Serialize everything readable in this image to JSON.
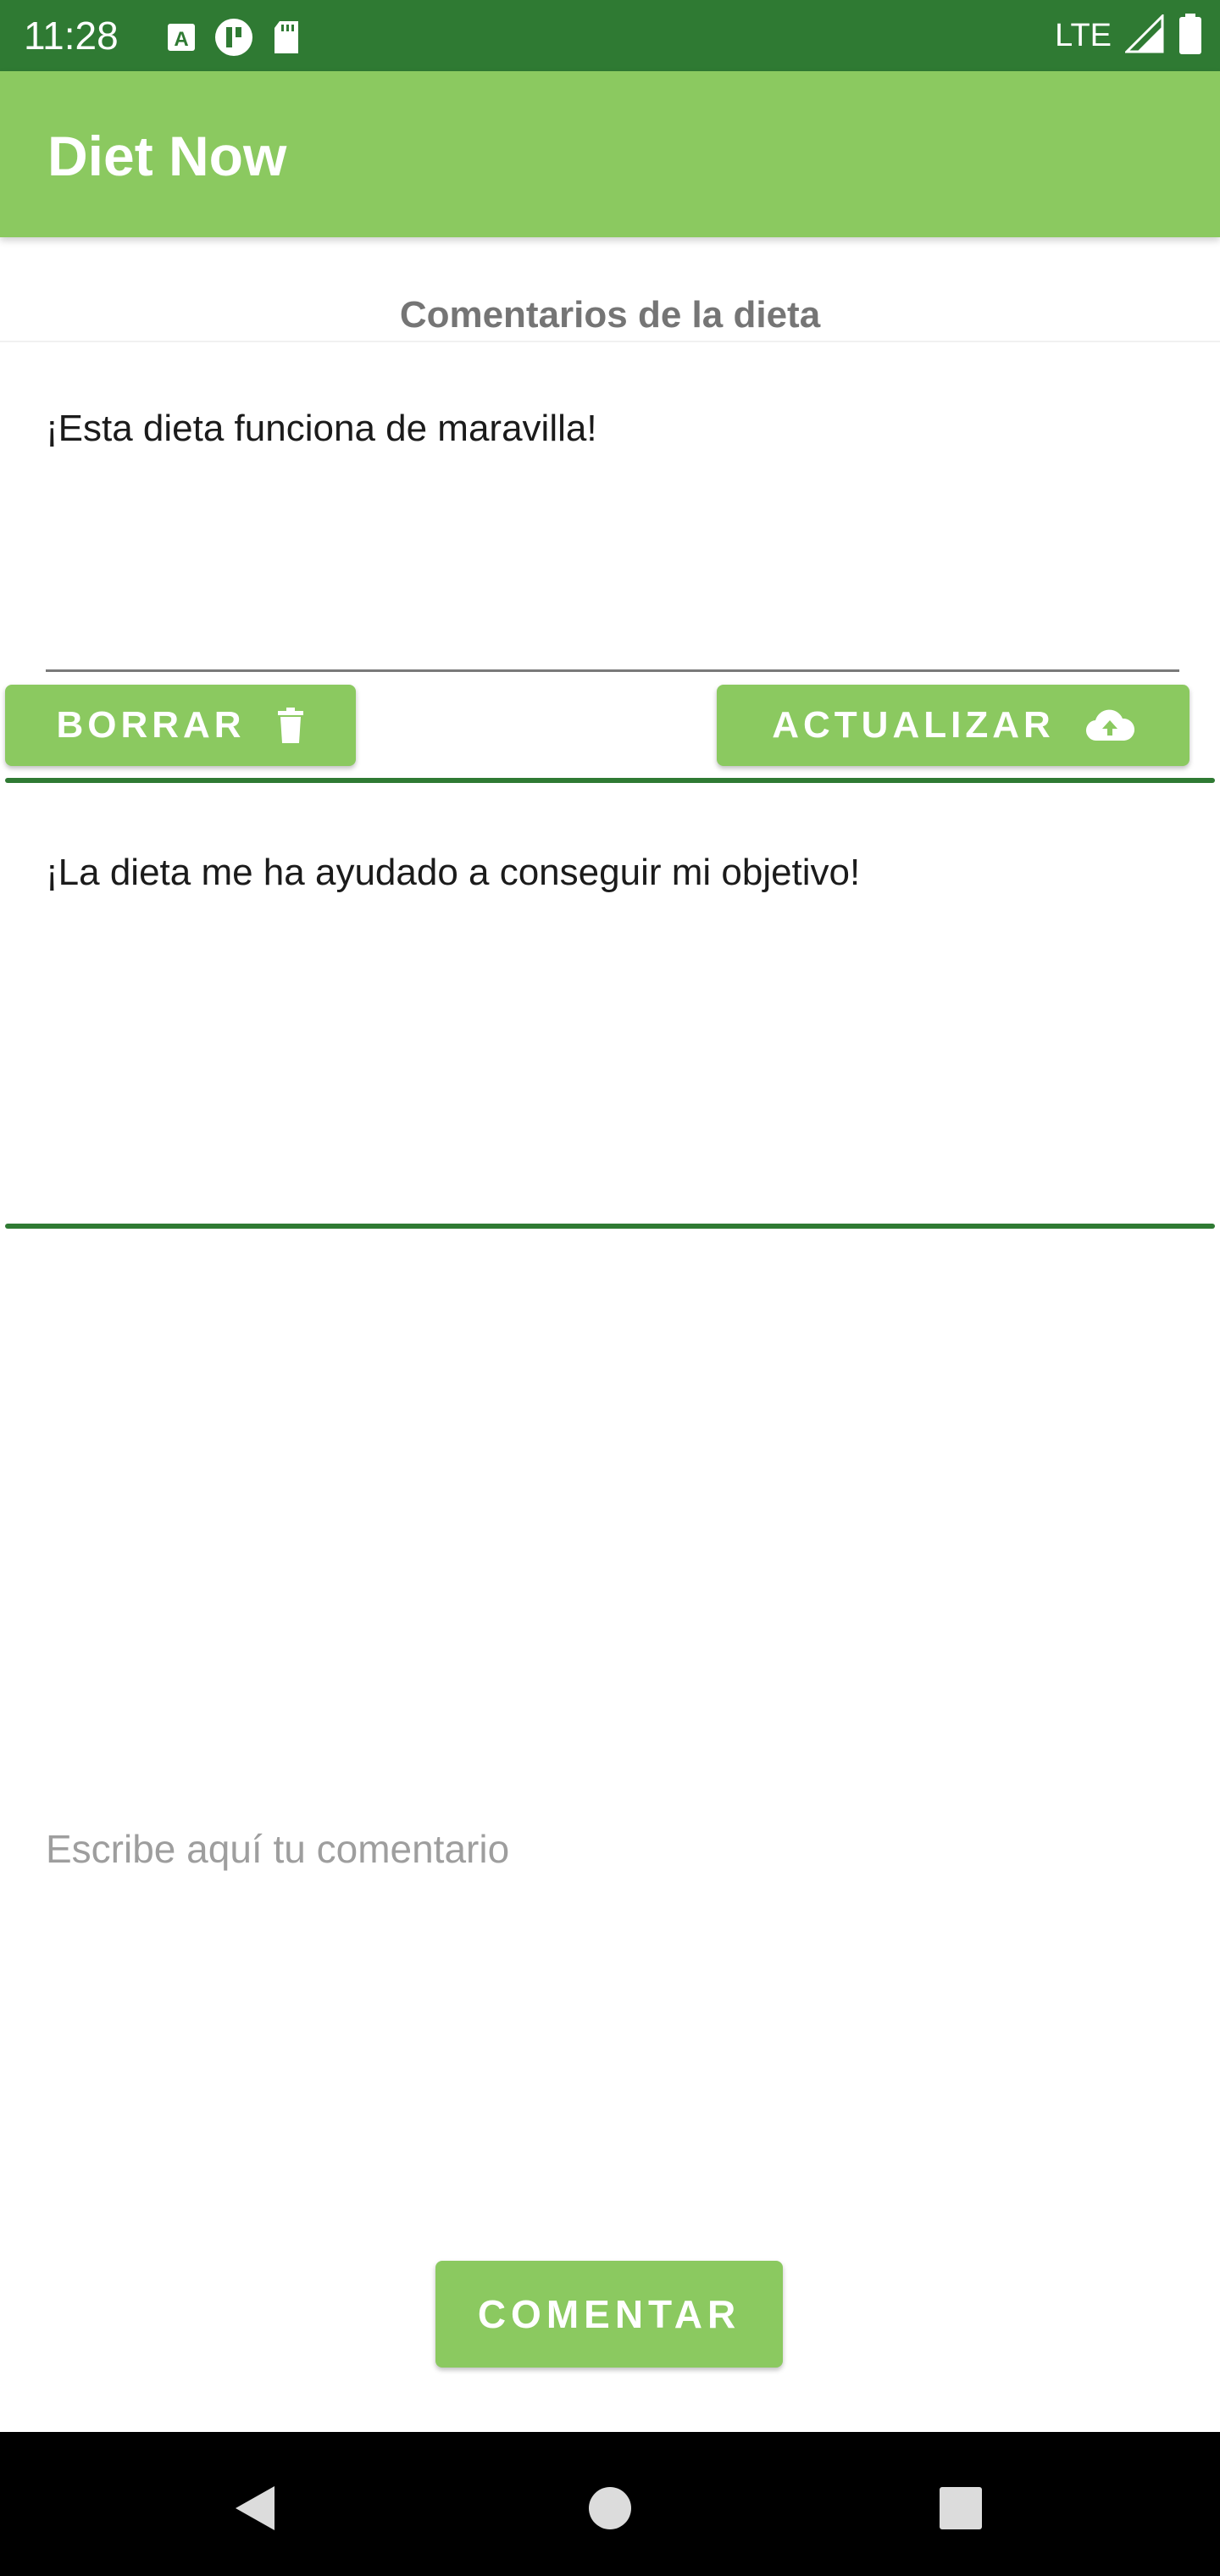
{
  "status_bar": {
    "time": "11:28",
    "network": "LTE",
    "icons_left": [
      "keyboard-a-icon",
      "pause-circle-icon",
      "sd-card-icon"
    ],
    "icons_right": [
      "signal-icon",
      "battery-icon"
    ]
  },
  "app_bar": {
    "title": "Diet Now"
  },
  "section": {
    "title": "Comentarios de la dieta"
  },
  "comments": [
    {
      "text": "¡Esta dieta funciona de maravilla!",
      "delete_label": "BORRAR",
      "update_label": "ACTUALIZAR"
    },
    {
      "text": "¡La dieta me ha ayudado a conseguir mi objetivo!"
    }
  ],
  "new_comment": {
    "placeholder": "Escribe aquí tu comentario",
    "value": "",
    "submit_label": "COMENTAR"
  },
  "colors": {
    "primary": "#8bc960",
    "primary_dark": "#2f7a33",
    "title_gray": "#757575"
  },
  "nav": {
    "icons": [
      "back-triangle-icon",
      "home-circle-icon",
      "recents-square-icon"
    ]
  }
}
